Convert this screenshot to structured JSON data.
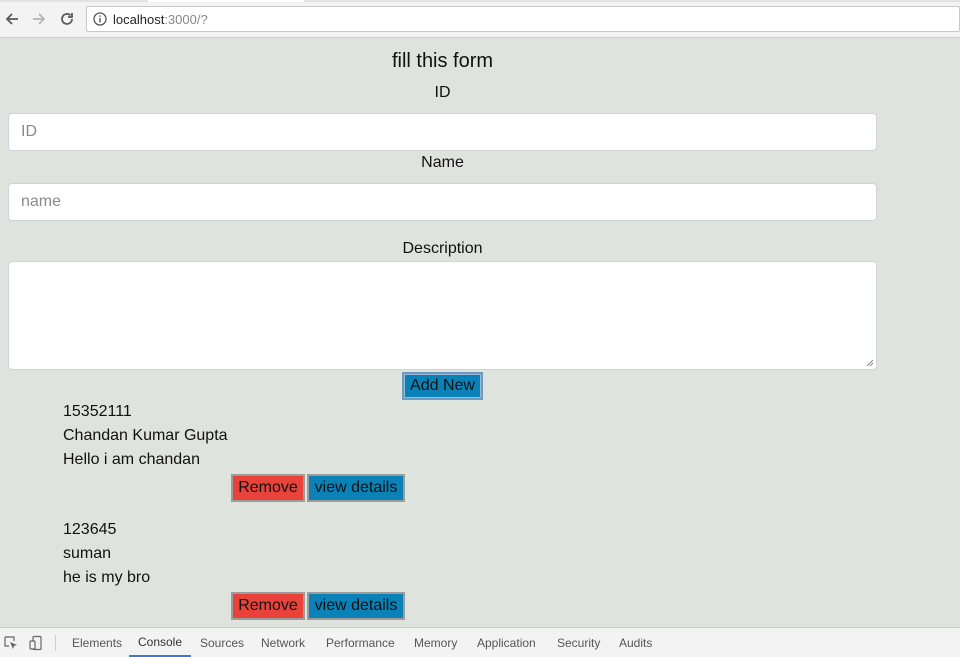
{
  "browser": {
    "url_host": "localhost",
    "url_path": ":3000/?",
    "icons": {
      "back": "back-arrow-icon",
      "forward": "forward-arrow-icon",
      "reload": "reload-icon",
      "info": "info-icon"
    }
  },
  "form": {
    "title": "fill this form",
    "id_label": "ID",
    "id_placeholder": "ID",
    "id_value": "",
    "name_label": "Name",
    "name_placeholder": "name",
    "name_value": "",
    "description_label": "Description",
    "description_value": "",
    "add_button": "Add New"
  },
  "items": [
    {
      "id": "15352111",
      "name": "Chandan Kumar Gupta",
      "description": "Hello i am chandan",
      "remove": "Remove",
      "view": "view details"
    },
    {
      "id": "123645",
      "name": "suman",
      "description": "he is my bro",
      "remove": "Remove",
      "view": "view details"
    }
  ],
  "devtools": {
    "tabs": [
      "Elements",
      "Console",
      "Sources",
      "Network",
      "Performance",
      "Memory",
      "Application",
      "Security",
      "Audits"
    ],
    "active_tab": "Console"
  },
  "colors": {
    "page_bg": "#dfe3dd",
    "primary_button": "#0a82b8",
    "danger_button": "#e8423a",
    "active_tab_underline": "#3879d9"
  }
}
